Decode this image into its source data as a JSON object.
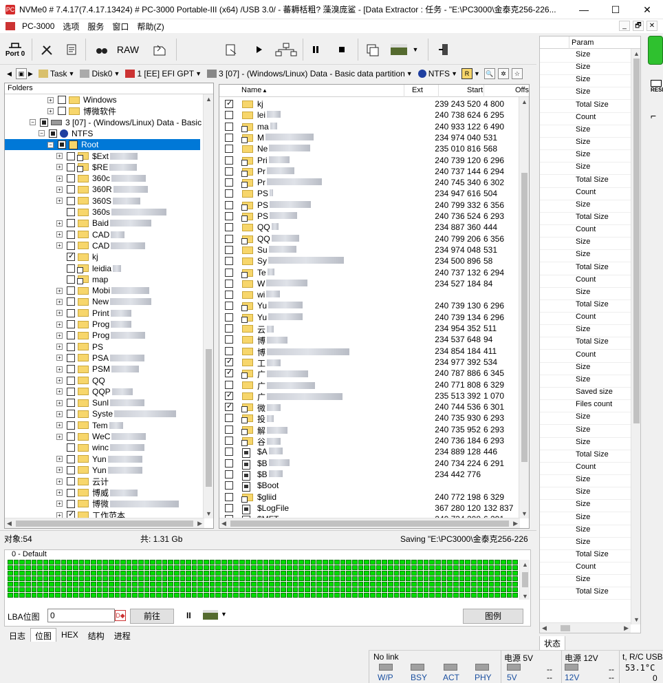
{
  "window": {
    "app_icon_text": "PC",
    "title": "NVMe0 # 7.4.17(7.4.17.13424) # PC-3000 Portable-III (x64) /USB 3.0/ - 蕃耨栝粗? 藻溴庞鲨    - [Data Extractor : 任务 - \"E:\\PC3000\\金泰克256-226...",
    "min": "—",
    "max": "☐",
    "close": "✕"
  },
  "menu": {
    "items": [
      "PC-3000",
      "选项",
      "服务",
      "窗口",
      "帮助(Z)"
    ],
    "mdi": [
      "_",
      "🗗",
      "✕"
    ]
  },
  "toolbar": {
    "port_label": "Port 0",
    "raw_label": "RAW"
  },
  "pathbar": {
    "task": "Task",
    "disk": "Disk0",
    "gpt": "1 [EE] EFI GPT",
    "partition": "3 [07] - (Windows/Linux) Data - Basic data partition",
    "fs": "NTFS",
    "fs_root": "R"
  },
  "tree": {
    "header": "Folders",
    "rows": [
      {
        "label": "Windows",
        "indent": 4,
        "exp": "+",
        "chk": "off",
        "icon": "folder"
      },
      {
        "label": "博微软件",
        "indent": 4,
        "exp": "+",
        "chk": "off",
        "icon": "folder"
      },
      {
        "label": "3 [07] - (Windows/Linux) Data - Basic d",
        "indent": 2,
        "exp": "−",
        "chk": "part",
        "icon": "disk"
      },
      {
        "label": "NTFS",
        "indent": 3,
        "exp": "−",
        "chk": "part",
        "icon": "info"
      },
      {
        "label": "Root",
        "indent": 4,
        "exp": "−",
        "chk": "part",
        "icon": "root",
        "sel": true
      },
      {
        "label": "$Ext",
        "indent": 5,
        "exp": "+",
        "chk": "off",
        "icon": "link",
        "blur": 40
      },
      {
        "label": "$RE",
        "indent": 5,
        "exp": "+",
        "chk": "off",
        "icon": "link",
        "blur": 40
      },
      {
        "label": "360c",
        "indent": 5,
        "exp": "+",
        "chk": "off",
        "icon": "folder",
        "blur": 50
      },
      {
        "label": "360R",
        "indent": 5,
        "exp": "+",
        "chk": "off",
        "icon": "folder",
        "blur": 50
      },
      {
        "label": "360S",
        "indent": 5,
        "exp": "+",
        "chk": "off",
        "icon": "folder",
        "blur": 40
      },
      {
        "label": "360s",
        "indent": 5,
        "exp": "",
        "chk": "off",
        "icon": "folder",
        "blur": 80
      },
      {
        "label": "Baid",
        "indent": 5,
        "exp": "+",
        "chk": "off",
        "icon": "folder",
        "blur": 60
      },
      {
        "label": "CAD",
        "indent": 5,
        "exp": "+",
        "chk": "off",
        "icon": "folder",
        "blur": 20
      },
      {
        "label": "CAD",
        "indent": 5,
        "exp": "+",
        "chk": "off",
        "icon": "folder",
        "blur": 50
      },
      {
        "label": "kj",
        "indent": 5,
        "exp": "",
        "chk": "on",
        "icon": "folder"
      },
      {
        "label": "leidia",
        "indent": 5,
        "exp": "",
        "chk": "off",
        "icon": "link",
        "blur": 12
      },
      {
        "label": "map",
        "indent": 5,
        "exp": "",
        "chk": "off",
        "icon": "link"
      },
      {
        "label": "Mobi",
        "indent": 5,
        "exp": "+",
        "chk": "off",
        "icon": "folder",
        "blur": 55
      },
      {
        "label": "New",
        "indent": 5,
        "exp": "+",
        "chk": "off",
        "icon": "folder",
        "blur": 60
      },
      {
        "label": "Print",
        "indent": 5,
        "exp": "+",
        "chk": "off",
        "icon": "folder",
        "blur": 30
      },
      {
        "label": "Prog",
        "indent": 5,
        "exp": "+",
        "chk": "off",
        "icon": "folder",
        "blur": 30
      },
      {
        "label": "Prog",
        "indent": 5,
        "exp": "+",
        "chk": "off",
        "icon": "folder",
        "blur": 50
      },
      {
        "label": "PS",
        "indent": 5,
        "exp": "+",
        "chk": "off",
        "icon": "folder"
      },
      {
        "label": "PSA",
        "indent": 5,
        "exp": "+",
        "chk": "off",
        "icon": "folder",
        "blur": 50
      },
      {
        "label": "PSM",
        "indent": 5,
        "exp": "+",
        "chk": "off",
        "icon": "folder",
        "blur": 40
      },
      {
        "label": "QQ",
        "indent": 5,
        "exp": "+",
        "chk": "off",
        "icon": "folder"
      },
      {
        "label": "QQP",
        "indent": 5,
        "exp": "+",
        "chk": "off",
        "icon": "folder",
        "blur": 30
      },
      {
        "label": "Sunl",
        "indent": 5,
        "exp": "+",
        "chk": "off",
        "icon": "folder",
        "blur": 50
      },
      {
        "label": "Syste",
        "indent": 5,
        "exp": "+",
        "chk": "off",
        "icon": "folder",
        "blur": 90
      },
      {
        "label": "Tem",
        "indent": 5,
        "exp": "+",
        "chk": "off",
        "icon": "folder",
        "blur": 20
      },
      {
        "label": "WeC",
        "indent": 5,
        "exp": "+",
        "chk": "off",
        "icon": "folder",
        "blur": 50
      },
      {
        "label": "winc",
        "indent": 5,
        "exp": "",
        "chk": "off",
        "icon": "folder",
        "blur": 50
      },
      {
        "label": "Yun",
        "indent": 5,
        "exp": "+",
        "chk": "off",
        "icon": "folder",
        "blur": 50
      },
      {
        "label": "Yun",
        "indent": 5,
        "exp": "+",
        "chk": "off",
        "icon": "folder",
        "blur": 50
      },
      {
        "label": "云计",
        "indent": 5,
        "exp": "+",
        "chk": "off",
        "icon": "folder"
      },
      {
        "label": "博威",
        "indent": 5,
        "exp": "+",
        "chk": "off",
        "icon": "folder",
        "blur": 40
      },
      {
        "label": "博微",
        "indent": 5,
        "exp": "+",
        "chk": "off",
        "icon": "folder",
        "blur": 100
      },
      {
        "label": "工作范本",
        "indent": 5,
        "exp": "+",
        "chk": "on",
        "icon": "folder"
      }
    ]
  },
  "list": {
    "headers": {
      "name": "Name",
      "ext": "Ext",
      "start": "Start",
      "offs": "Offs"
    },
    "rows": [
      {
        "name": "kj",
        "chk": "on",
        "icon": "folder",
        "start": "239 243 520",
        "offs": "4 800"
      },
      {
        "name": "lei",
        "chk": "off",
        "icon": "folder",
        "start": "240 738 624",
        "offs": "6 295",
        "blur": 20
      },
      {
        "name": "ma",
        "chk": "off",
        "icon": "link",
        "start": "240 933 122",
        "offs": "6 490",
        "blur": 10
      },
      {
        "name": "M",
        "chk": "off",
        "icon": "link",
        "start": "234 974 040",
        "offs": "531",
        "blur": 70
      },
      {
        "name": "Ne",
        "chk": "off",
        "icon": "folder",
        "start": "235 010 816",
        "offs": "568",
        "blur": 60
      },
      {
        "name": "Pri",
        "chk": "off",
        "icon": "link",
        "start": "240 739 120",
        "offs": "6 296",
        "blur": 30
      },
      {
        "name": "Pr",
        "chk": "off",
        "icon": "link",
        "start": "240 737 144",
        "offs": "6 294",
        "blur": 40
      },
      {
        "name": "Pr",
        "chk": "off",
        "icon": "link",
        "start": "240 745 340",
        "offs": "6 302",
        "blur": 80
      },
      {
        "name": "PS",
        "chk": "off",
        "icon": "folder",
        "start": "234 947 616",
        "offs": "504",
        "blur": 5
      },
      {
        "name": "PS",
        "chk": "off",
        "icon": "link",
        "start": "240 799 332",
        "offs": "6 356",
        "blur": 60
      },
      {
        "name": "PS",
        "chk": "off",
        "icon": "link",
        "start": "240 736 524",
        "offs": "6 293",
        "blur": 40
      },
      {
        "name": "QQ",
        "chk": "off",
        "icon": "folder",
        "start": "234 887 360",
        "offs": "444",
        "blur": 10
      },
      {
        "name": "QQ",
        "chk": "off",
        "icon": "link",
        "start": "240 799 206",
        "offs": "6 356",
        "blur": 40
      },
      {
        "name": "Su",
        "chk": "off",
        "icon": "folder",
        "start": "234 974 048",
        "offs": "531",
        "blur": 40
      },
      {
        "name": "Sy",
        "chk": "off",
        "icon": "folder",
        "start": "234 500 896",
        "offs": "58",
        "blur": 110
      },
      {
        "name": "Te",
        "chk": "off",
        "icon": "link",
        "start": "240 737 132",
        "offs": "6 294",
        "blur": 10
      },
      {
        "name": "W",
        "chk": "off",
        "icon": "folder",
        "start": "234 527 184",
        "offs": "84",
        "blur": 60
      },
      {
        "name": "wi",
        "chk": "off",
        "icon": "folder",
        "start": "",
        "offs": "",
        "blur": 20
      },
      {
        "name": "Yu",
        "chk": "off",
        "icon": "link",
        "start": "240 739 130",
        "offs": "6 296",
        "blur": 50
      },
      {
        "name": "Yu",
        "chk": "off",
        "icon": "link",
        "start": "240 739 134",
        "offs": "6 296",
        "blur": 50
      },
      {
        "name": "云",
        "chk": "off",
        "icon": "folder",
        "start": "234 954 352",
        "offs": "511",
        "blur": 10
      },
      {
        "name": "博",
        "chk": "off",
        "icon": "folder",
        "start": "234 537 648",
        "offs": "94",
        "blur": 30
      },
      {
        "name": "博",
        "chk": "off",
        "icon": "folder",
        "start": "234 854 184",
        "offs": "411",
        "blur": 120
      },
      {
        "name": "工",
        "chk": "on",
        "icon": "folder",
        "start": "234 977 392",
        "offs": "534",
        "blur": 20
      },
      {
        "name": "广",
        "chk": "on",
        "icon": "link",
        "start": "240 787 886",
        "offs": "6 345",
        "blur": 60
      },
      {
        "name": "广",
        "chk": "off",
        "icon": "folder",
        "start": "240 771 808",
        "offs": "6 329",
        "blur": 70
      },
      {
        "name": "广",
        "chk": "on",
        "icon": "folder",
        "start": "235 513 392",
        "offs": "1 070",
        "blur": 110
      },
      {
        "name": "微",
        "chk": "on",
        "icon": "link",
        "start": "240 744 536",
        "offs": "6 301",
        "blur": 20
      },
      {
        "name": "投",
        "chk": "off",
        "icon": "link",
        "start": "240 735 930",
        "offs": "6 293",
        "blur": 10
      },
      {
        "name": "解",
        "chk": "off",
        "icon": "link",
        "start": "240 735 952",
        "offs": "6 293",
        "blur": 30
      },
      {
        "name": "谷",
        "chk": "off",
        "icon": "link",
        "start": "240 736 184",
        "offs": "6 293",
        "blur": 20
      },
      {
        "name": "$A",
        "chk": "off",
        "icon": "file",
        "start": "234 889 128",
        "offs": "446",
        "blur": 20
      },
      {
        "name": "$B",
        "chk": "off",
        "icon": "file",
        "start": "240 734 224",
        "offs": "6 291",
        "blur": 30
      },
      {
        "name": "$B",
        "chk": "off",
        "icon": "file",
        "start": "234 442 776",
        "offs": "",
        "blur": 20
      },
      {
        "name": "$Boot",
        "chk": "off",
        "icon": "file",
        "start": "",
        "offs": ""
      },
      {
        "name": "$gliid",
        "chk": "off",
        "icon": "link",
        "start": "240 772 198",
        "offs": "6 329"
      },
      {
        "name": "$LogFile",
        "chk": "off",
        "icon": "file",
        "start": "367 280 120",
        "offs": "132 837"
      },
      {
        "name": "$MFT",
        "chk": "off",
        "icon": "file",
        "start": "240 734 208",
        "offs": "6 291"
      }
    ]
  },
  "status": {
    "objects": "对象:54",
    "total": "共: 1.31 Gb",
    "saving": "Saving  \"E:\\PC3000\\金泰克256-226"
  },
  "map": {
    "legend": "0 - Default",
    "lba_label": "LBA位图",
    "lba_value": "0",
    "goto_button": "前往",
    "legend_button": "图例",
    "pause": "II"
  },
  "bottom_tabs": [
    "日志",
    "位图",
    "HEX",
    "结构",
    "进程"
  ],
  "param": {
    "header": "Param",
    "rows": [
      "Size",
      "Size",
      "Size",
      "Size",
      "Total Size",
      "Count",
      "Size",
      "Size",
      "Size",
      "Size",
      "Total Size",
      "Count",
      "Size",
      "Total Size",
      "Count",
      "Size",
      "Size",
      "Total Size",
      "Count",
      "Size",
      "Total Size",
      "Count",
      "Size",
      "Total Size",
      "Count",
      "Size",
      "Size",
      "Saved size",
      "Files count",
      "Size",
      "Size",
      "Size",
      "Total Size",
      "Count",
      "Size",
      "Size",
      "Size",
      "Size",
      "Size",
      "Size",
      "Total Size",
      "Count",
      "Size",
      "Total Size"
    ],
    "tab": "状态"
  },
  "right_strip": {
    "reset_label": "RESE"
  },
  "indicators": {
    "link": "No link",
    "leds": [
      "W/P",
      "BSY",
      "ACT",
      "PHY"
    ],
    "power5": "电源 5V",
    "power5_btn": "5V",
    "power12": "电源 12V",
    "power12_btn": "12V",
    "dash": "--",
    "temp_label": "t, R/C USB",
    "temp_value": "53.1°C",
    "temp_zero": "0"
  }
}
